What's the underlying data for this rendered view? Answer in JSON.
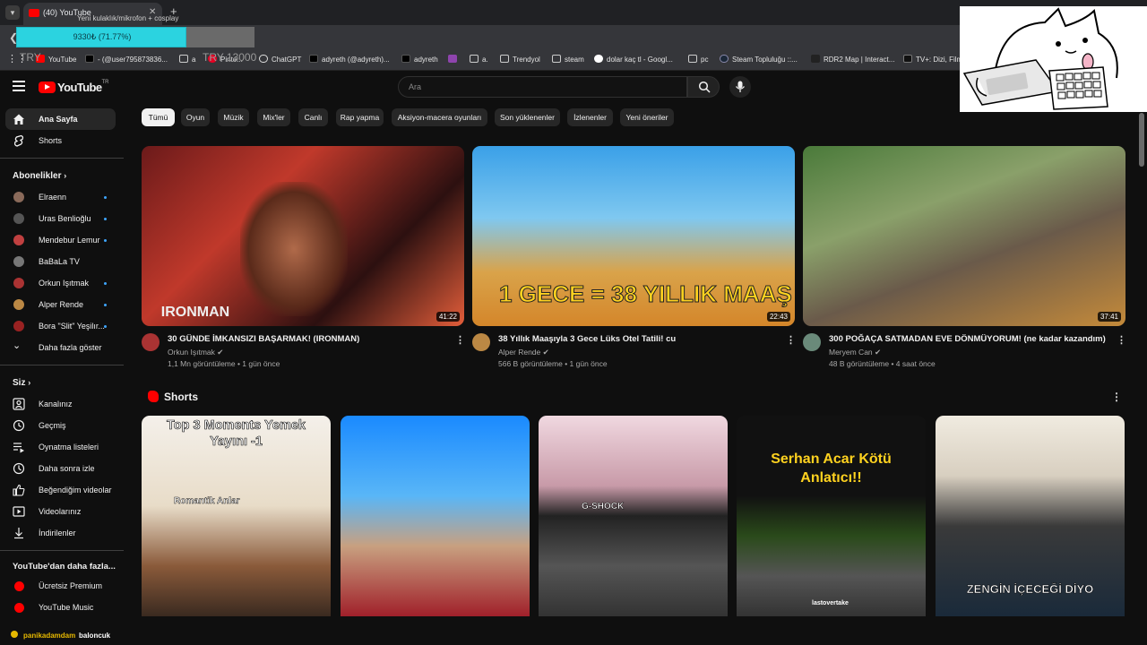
{
  "browser": {
    "tab_title": "(40) YouTube",
    "tooltip": "Yeni kulaklık/mikrofon + cosplay",
    "new_tab": "+",
    "bookmarks": [
      "YouTube",
      "- (@user795873836...",
      "a",
      "Pinte...",
      "ChatGPT",
      "adyreth (@adyreth)...",
      "adyreth",
      "a.",
      "Trendyol",
      "steam",
      "dolar kaç tl - Googl...",
      "pc",
      "Steam Topluluğu ::...",
      "RDR2 Map | Interact...",
      "TV+: Dizi, Film"
    ]
  },
  "overlay": {
    "donation_text": "9330₺ (71.77%)",
    "donation_progress": 71.77,
    "left_code": "TRY",
    "right_code": "TRY 13000"
  },
  "header": {
    "logo_text": "YouTube",
    "logo_sup": "TR",
    "search_placeholder": "Ara"
  },
  "sidebar": {
    "main": [
      {
        "label": "Ana Sayfa",
        "icon": "home-icon"
      },
      {
        "label": "Shorts",
        "icon": "shorts-icon"
      }
    ],
    "subs_title": "Abonelikler",
    "subscriptions": [
      {
        "label": "Elraenn",
        "color": "#8a6a5a"
      },
      {
        "label": "Uras Benlioğlu",
        "color": "#444"
      },
      {
        "label": "Mendebur Lemur",
        "color": "#c04040"
      },
      {
        "label": "BaBaLa TV",
        "color": "#777"
      },
      {
        "label": "Orkun Işıtmak",
        "color": "#a33"
      },
      {
        "label": "Alper Rende",
        "color": "#b84"
      },
      {
        "label": "Bora \"Slit\" Yeşilır...",
        "color": "#922"
      }
    ],
    "show_more": "Daha fazla göster",
    "you_title": "Siz",
    "you_items": [
      {
        "label": "Kanalınız",
        "icon": "channel-icon"
      },
      {
        "label": "Geçmiş",
        "icon": "history-icon"
      },
      {
        "label": "Oynatma listeleri",
        "icon": "playlist-icon"
      },
      {
        "label": "Daha sonra izle",
        "icon": "watch-later-icon"
      },
      {
        "label": "Beğendiğim videolar",
        "icon": "like-icon"
      },
      {
        "label": "Videolarınız",
        "icon": "your-videos-icon"
      },
      {
        "label": "İndirilenler",
        "icon": "download-icon"
      }
    ],
    "more_title": "YouTube'dan daha fazla...",
    "more_items": [
      {
        "label": "Ücretsiz Premium"
      },
      {
        "label": "YouTube Music"
      }
    ]
  },
  "chips": [
    "Tümü",
    "Oyun",
    "Müzik",
    "Mix'ler",
    "Canlı",
    "Rap yapma",
    "Aksiyon-macera oyunları",
    "Son yüklenenler",
    "İzlenenler",
    "Yeni öneriler"
  ],
  "videos": [
    {
      "title": "30 GÜNDE İMKANSIZI BAŞARMAK! (IRONMAN)",
      "channel": "Orkun Işıtmak",
      "meta": "1,1 Mn görüntüleme • 1 gün önce",
      "duration": "41:22",
      "overlay": "IRONMAN"
    },
    {
      "title": "38 Yıllık Maaşıyla 3 Gece Lüks Otel Tatili! cu",
      "channel": "Alper Rende",
      "meta": "566 B görüntüleme • 1 gün önce",
      "duration": "22:43",
      "overlay": "1 GECE = 38 YILLIK MAAŞ"
    },
    {
      "title": "300 POĞAÇA SATMADAN EVE DÖNMÜYORUM! (ne kadar kazandım)",
      "channel": "Meryem Can",
      "meta": "48 B görüntüleme • 4 saat önce",
      "duration": "37:41",
      "overlay": ""
    }
  ],
  "shorts_title": "Shorts",
  "shorts": [
    {
      "text": "Top 3 Moments Yemek Yayını -1",
      "sub": "Romantik Anlar"
    },
    {
      "text": "",
      "sub": ""
    },
    {
      "text": "",
      "sub": "G-SHOCK"
    },
    {
      "text": "Serhan Acar Kötü Anlatıcı!!",
      "sub": "lastovertake"
    },
    {
      "text": "ZENGİN İÇECEĞİ DİYO",
      "sub": ""
    }
  ],
  "bottom_chat": {
    "user": "panikadamdam",
    "message": "baloncuk"
  }
}
